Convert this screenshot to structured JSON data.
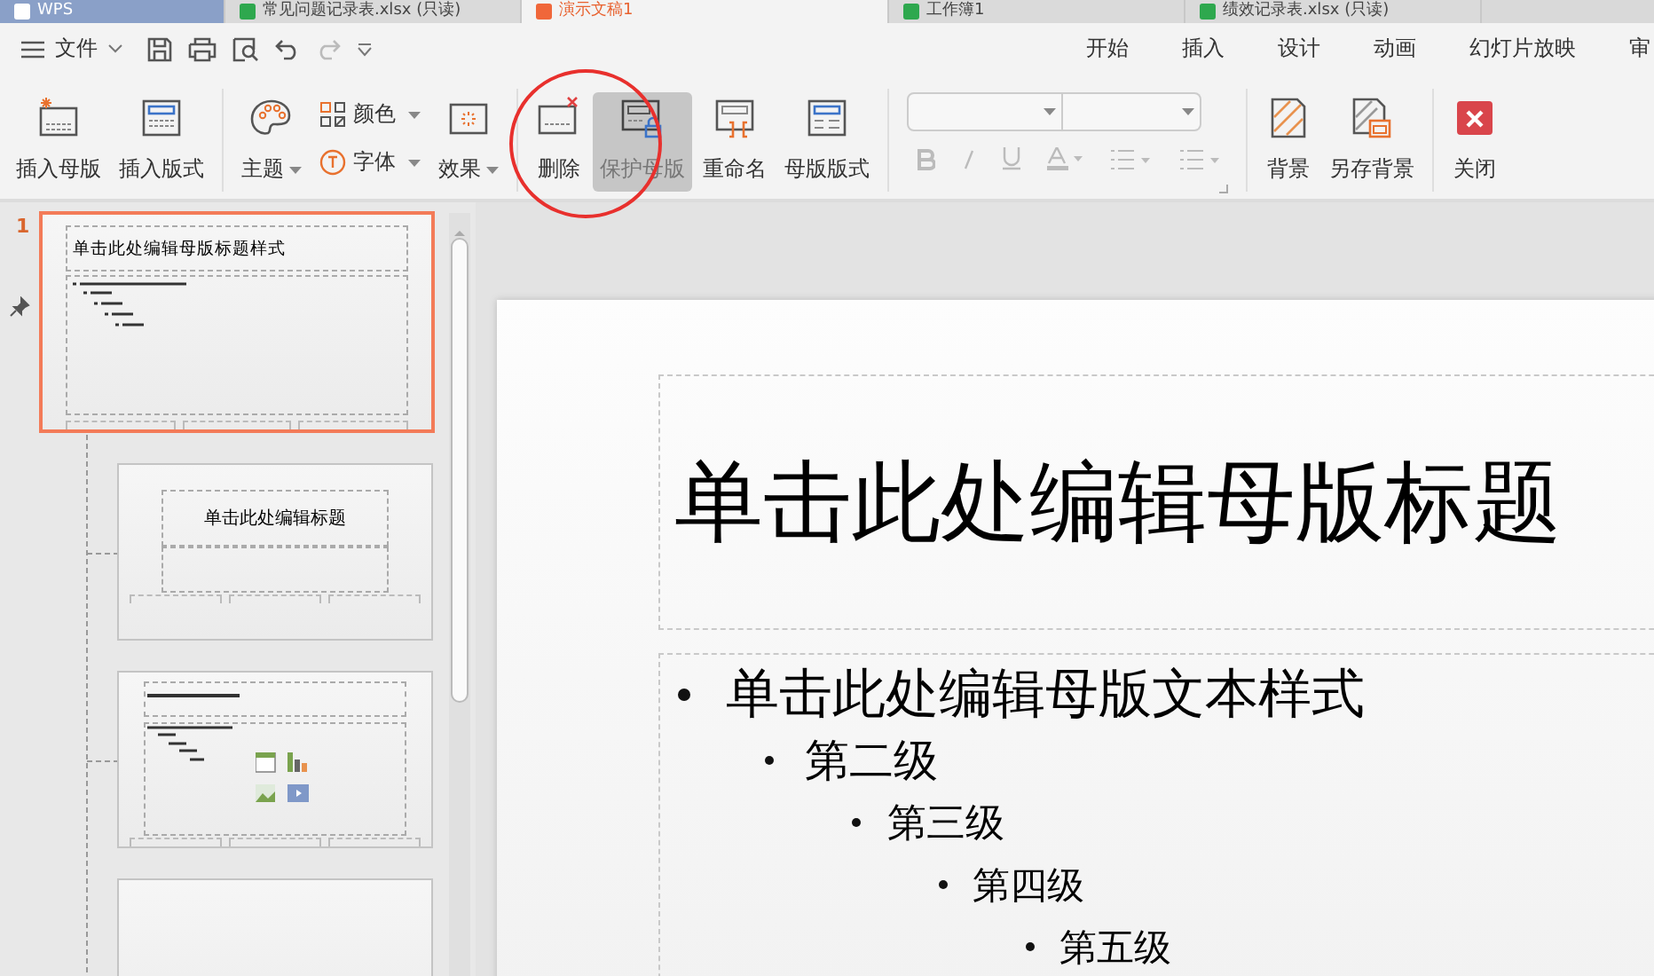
{
  "tabs": [
    {
      "label": "WPS",
      "kind": "home",
      "selected": false
    },
    {
      "label": "常见问题记录表.xlsx (只读)",
      "kind": "sheet",
      "selected": false
    },
    {
      "label": "演示文稿1",
      "kind": "slides",
      "selected": true
    },
    {
      "label": "工作簿1",
      "kind": "sheet",
      "selected": false
    },
    {
      "label": "绩效记录表.xlsx (只读)",
      "kind": "sheet",
      "selected": false
    }
  ],
  "menu": {
    "file": "文件",
    "tabs": [
      {
        "label": "开始",
        "selected": false
      },
      {
        "label": "插入",
        "selected": false
      },
      {
        "label": "设计",
        "selected": false
      },
      {
        "label": "动画",
        "selected": false
      },
      {
        "label": "幻灯片放映",
        "selected": false
      },
      {
        "label": "审",
        "selected": false
      }
    ]
  },
  "ribbon": {
    "groups": [
      {
        "kind": "buttons",
        "items": [
          {
            "kind": "large",
            "label": "插入母版",
            "dropdown": false,
            "pressed": false
          },
          {
            "kind": "large",
            "label": "插入版式",
            "dropdown": false,
            "pressed": false
          }
        ]
      },
      {
        "kind": "buttons",
        "items": [
          {
            "kind": "large",
            "label": "主题",
            "dropdown": true,
            "pressed": false
          },
          {
            "kind": "stack",
            "items": [
              {
                "label": "颜色",
                "dropdown": true
              },
              {
                "label": "字体",
                "dropdown": true
              }
            ]
          },
          {
            "kind": "large",
            "label": "效果",
            "dropdown": true,
            "pressed": false
          }
        ]
      },
      {
        "kind": "buttons",
        "items": [
          {
            "kind": "large",
            "label": "删除",
            "dropdown": false,
            "pressed": false
          },
          {
            "kind": "large",
            "label": "保护母版",
            "dropdown": false,
            "pressed": true
          },
          {
            "kind": "large",
            "label": "重命名",
            "dropdown": false,
            "pressed": false
          },
          {
            "kind": "large",
            "label": "母版版式",
            "dropdown": false,
            "pressed": false
          }
        ]
      },
      {
        "kind": "font",
        "disabled": true
      },
      {
        "kind": "buttons",
        "items": [
          {
            "kind": "large",
            "label": "背景",
            "dropdown": false,
            "pressed": false
          },
          {
            "kind": "large",
            "label": "另存背景",
            "dropdown": false,
            "pressed": false
          }
        ]
      },
      {
        "kind": "buttons",
        "items": [
          {
            "kind": "large",
            "label": "关闭",
            "dropdown": false,
            "pressed": false
          }
        ]
      }
    ]
  },
  "thumbnails": [
    {
      "number": "1",
      "kind": "master",
      "title": "单击此处编辑母版标题样式",
      "selected": true
    },
    {
      "kind": "title",
      "title": "单击此处编辑标题",
      "selected": false
    },
    {
      "kind": "content",
      "selected": false
    },
    {
      "kind": "blank",
      "selected": false
    }
  ],
  "slide": {
    "title": "单击此处编辑母版标题",
    "bullets": [
      {
        "text": "单击此处编辑母版文本样式",
        "children": [
          {
            "text": "第二级",
            "children": [
              {
                "text": "第三级",
                "children": [
                  {
                    "text": "第四级",
                    "children": [
                      {
                        "text": "第五级"
                      }
                    ]
                  }
                ]
              }
            ]
          }
        ]
      }
    ]
  }
}
